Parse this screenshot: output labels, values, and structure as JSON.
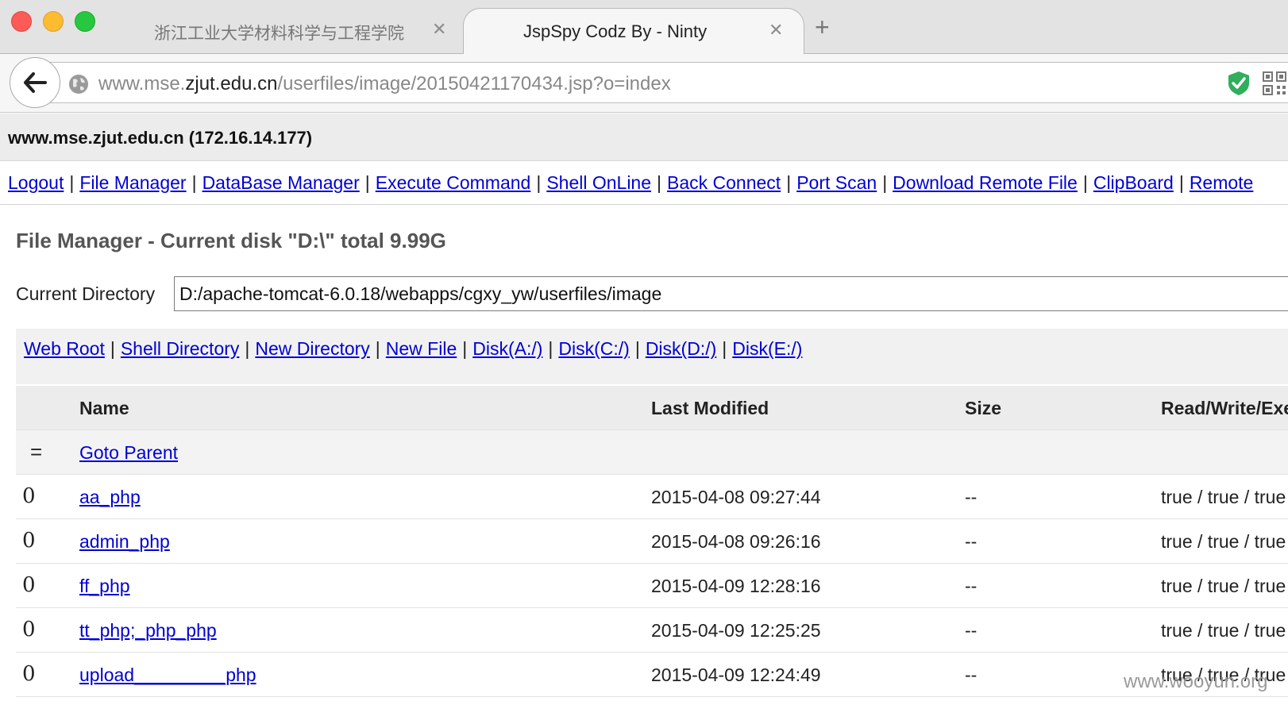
{
  "browser": {
    "tabs": [
      {
        "title": "浙江工业大学材料科学与工程学院",
        "active": false
      },
      {
        "title": "JspSpy Codz By - Ninty",
        "active": true
      }
    ],
    "tab_close_glyph": "✕",
    "new_tab_glyph": "+",
    "url_prefix": "www.mse.",
    "url_host": "zjut.edu.cn",
    "url_path": "/userfiles/image/20150421170434.jsp?o=index",
    "icons": [
      "back-arrow-icon",
      "globe-icon",
      "shield-check-icon",
      "qr-code-icon"
    ],
    "colors": {
      "close": "#fc5b57",
      "minimize": "#fdbb2f",
      "zoom": "#27c840",
      "shield": "#2fae5c"
    }
  },
  "page": {
    "host_line": "www.mse.zjut.edu.cn (172.16.14.177)",
    "menu": [
      "Logout",
      "File Manager",
      "DataBase Manager",
      "Execute Command",
      "Shell OnLine",
      "Back Connect",
      "Port Scan",
      "Download Remote File",
      "ClipBoard",
      "Remote"
    ],
    "menu_separator": "|",
    "fm_title": "File Manager - Current disk \"D:\\\" total 9.99G",
    "current_directory_label": "Current Directory",
    "current_directory_value": "D:/apache-tomcat-6.0.18/webapps/cgxy_yw/userfiles/image",
    "quick_links": [
      "Web Root",
      "Shell Directory",
      "New Directory",
      "New File",
      "Disk(A:/)",
      "Disk(C:/)",
      "Disk(D:/)",
      "Disk(E:/)"
    ],
    "table": {
      "headers": {
        "name": "Name",
        "last_modified": "Last Modified",
        "size": "Size",
        "rwe": "Read/Write/Execute"
      },
      "parent_icon": "=",
      "parent_label": "Goto Parent",
      "rows": [
        {
          "icon": "0",
          "name": "aa_php",
          "modified": "2015-04-08 09:27:44",
          "size": "--",
          "rwe": "true / true / true"
        },
        {
          "icon": "0",
          "name": "admin_php",
          "modified": "2015-04-08 09:26:16",
          "size": "--",
          "rwe": "true / true / true"
        },
        {
          "icon": "0",
          "name": "ff_php",
          "modified": "2015-04-09 12:28:16",
          "size": "--",
          "rwe": "true / true / true"
        },
        {
          "icon": "0",
          "name": "tt_php;_php_php",
          "modified": "2015-04-09 12:25:25",
          "size": "--",
          "rwe": "true / true / true"
        },
        {
          "icon": "0",
          "name": "upload_________php",
          "modified": "2015-04-09 12:24:49",
          "size": "--",
          "rwe": "true / true / true"
        }
      ]
    },
    "link_color": "#0000d4",
    "watermark": "www.wooyun.org"
  }
}
